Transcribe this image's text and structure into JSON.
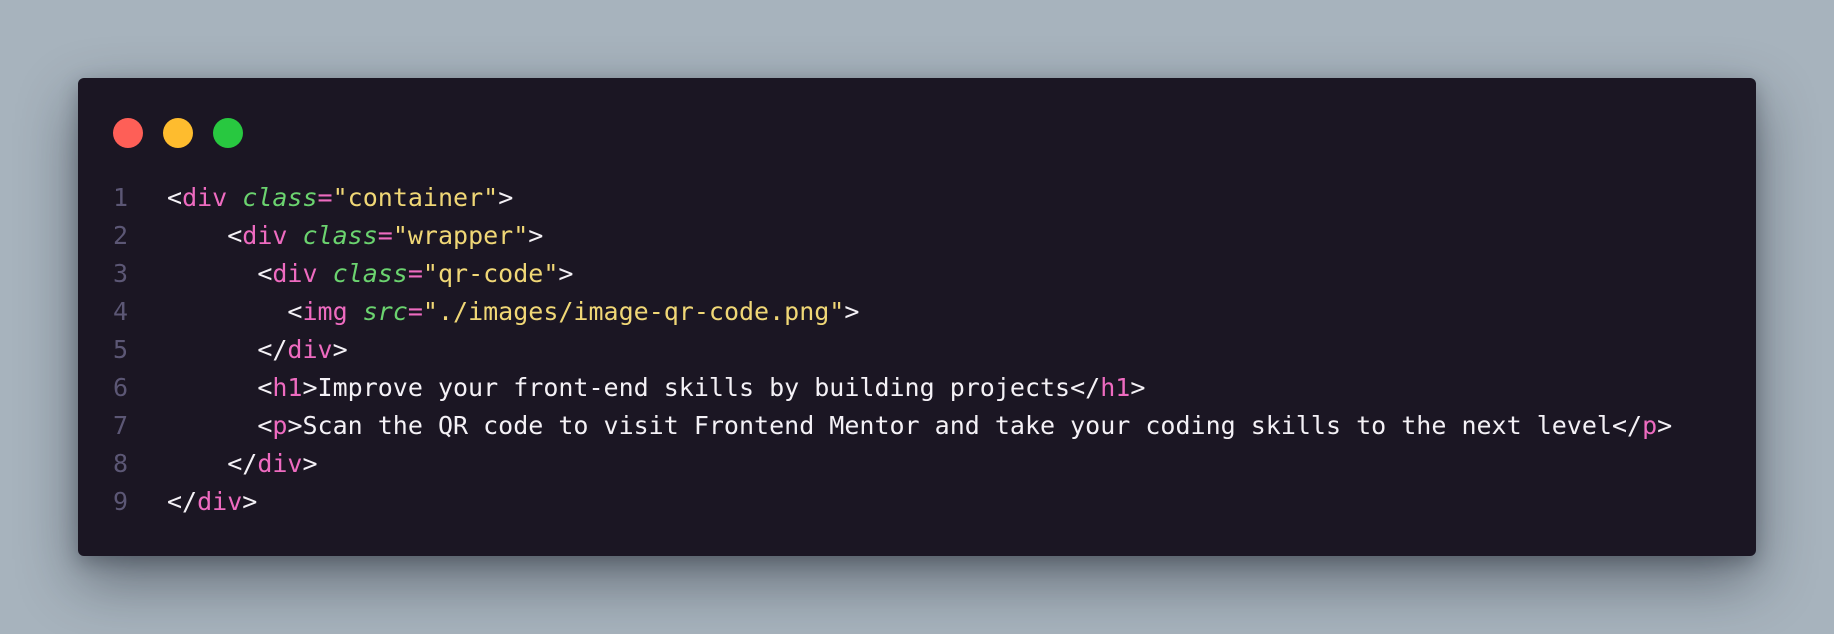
{
  "window": {
    "controls": [
      {
        "name": "close",
        "color": "#fe5f57"
      },
      {
        "name": "minimize",
        "color": "#febc2e"
      },
      {
        "name": "maximize",
        "color": "#28c840"
      }
    ]
  },
  "colors": {
    "background": "#a7b3bd",
    "editor_background": "#1b1623",
    "tag": "#ee6bc0",
    "attribute": "#6bd36f",
    "string": "#f0d776",
    "text": "#f4f1f6",
    "line_number": "#5c5775"
  },
  "code": {
    "lines": [
      {
        "number": "1",
        "indent": "",
        "tokens": [
          {
            "type": "punc",
            "text": "<"
          },
          {
            "type": "tag",
            "text": "div"
          },
          {
            "type": "punc",
            "text": " "
          },
          {
            "type": "attr",
            "text": "class"
          },
          {
            "type": "tag",
            "text": "="
          },
          {
            "type": "str",
            "text": "\"container\""
          },
          {
            "type": "punc",
            "text": ">"
          }
        ]
      },
      {
        "number": "2",
        "indent": "    ",
        "tokens": [
          {
            "type": "punc",
            "text": "<"
          },
          {
            "type": "tag",
            "text": "div"
          },
          {
            "type": "punc",
            "text": " "
          },
          {
            "type": "attr",
            "text": "class"
          },
          {
            "type": "tag",
            "text": "="
          },
          {
            "type": "str",
            "text": "\"wrapper\""
          },
          {
            "type": "punc",
            "text": ">"
          }
        ]
      },
      {
        "number": "3",
        "indent": "      ",
        "tokens": [
          {
            "type": "punc",
            "text": "<"
          },
          {
            "type": "tag",
            "text": "div"
          },
          {
            "type": "punc",
            "text": " "
          },
          {
            "type": "attr",
            "text": "class"
          },
          {
            "type": "tag",
            "text": "="
          },
          {
            "type": "str",
            "text": "\"qr-code\""
          },
          {
            "type": "punc",
            "text": ">"
          }
        ]
      },
      {
        "number": "4",
        "indent": "        ",
        "tokens": [
          {
            "type": "punc",
            "text": "<"
          },
          {
            "type": "tag",
            "text": "img"
          },
          {
            "type": "punc",
            "text": " "
          },
          {
            "type": "attr",
            "text": "src"
          },
          {
            "type": "tag",
            "text": "="
          },
          {
            "type": "str",
            "text": "\"./images/image-qr-code.png\""
          },
          {
            "type": "punc",
            "text": ">"
          }
        ]
      },
      {
        "number": "5",
        "indent": "      ",
        "tokens": [
          {
            "type": "punc",
            "text": "</"
          },
          {
            "type": "tag",
            "text": "div"
          },
          {
            "type": "punc",
            "text": ">"
          }
        ]
      },
      {
        "number": "6",
        "indent": "      ",
        "tokens": [
          {
            "type": "punc",
            "text": "<"
          },
          {
            "type": "tag",
            "text": "h1"
          },
          {
            "type": "punc",
            "text": ">"
          },
          {
            "type": "plain",
            "text": "Improve your front-end skills by building projects"
          },
          {
            "type": "punc",
            "text": "</"
          },
          {
            "type": "tag",
            "text": "h1"
          },
          {
            "type": "punc",
            "text": ">"
          }
        ]
      },
      {
        "number": "7",
        "indent": "      ",
        "tokens": [
          {
            "type": "punc",
            "text": "<"
          },
          {
            "type": "tag",
            "text": "p"
          },
          {
            "type": "punc",
            "text": ">"
          },
          {
            "type": "plain",
            "text": "Scan the QR code to visit Frontend Mentor and take your coding skills to the next level"
          },
          {
            "type": "punc",
            "text": "</"
          },
          {
            "type": "tag",
            "text": "p"
          },
          {
            "type": "punc",
            "text": ">"
          }
        ]
      },
      {
        "number": "8",
        "indent": "    ",
        "tokens": [
          {
            "type": "punc",
            "text": "</"
          },
          {
            "type": "tag",
            "text": "div"
          },
          {
            "type": "punc",
            "text": ">"
          }
        ]
      },
      {
        "number": "9",
        "indent": "",
        "tokens": [
          {
            "type": "punc",
            "text": "</"
          },
          {
            "type": "tag",
            "text": "div"
          },
          {
            "type": "punc",
            "text": ">"
          }
        ]
      }
    ]
  }
}
